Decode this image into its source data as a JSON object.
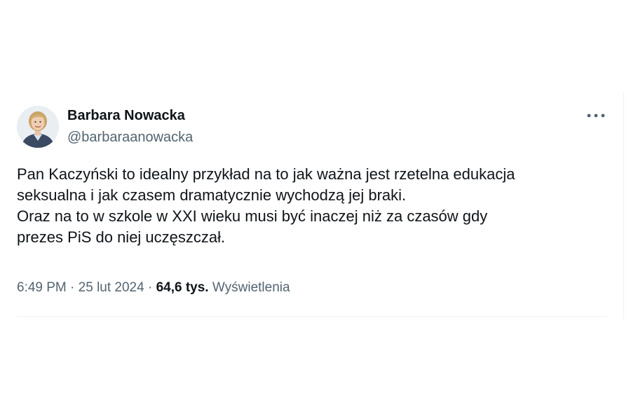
{
  "author": {
    "display_name": "Barbara Nowacka",
    "handle": "@barbaraanowacka"
  },
  "tweet": {
    "lines": [
      "Pan Kaczyński to idealny przykład na to jak ważna jest rzetelna edukacja",
      "seksualna i jak czasem dramatycznie wychodzą jej braki.",
      "Oraz na to w szkole w XXI wieku musi być inaczej niż za czasów gdy",
      "prezes PiS do niej uczęszczał."
    ]
  },
  "meta": {
    "time": "6:49 PM",
    "separator": "·",
    "date": "25 lut 2024",
    "views_count": "64,6 tys.",
    "views_label": "Wyświetlenia"
  },
  "icons": {
    "more": "more-horizontal-icon"
  },
  "colors": {
    "text_primary": "#0f1419",
    "text_secondary": "#536471",
    "divider": "#eff3f4"
  }
}
